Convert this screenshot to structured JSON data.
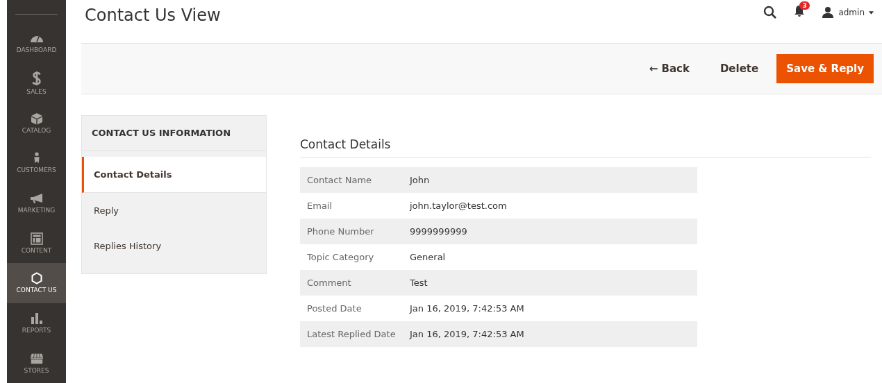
{
  "nav": [
    {
      "label": "DASHBOARD",
      "kind": "gauge",
      "selected": false
    },
    {
      "label": "SALES",
      "kind": "dollar",
      "selected": false
    },
    {
      "label": "CATALOG",
      "kind": "box",
      "selected": false
    },
    {
      "label": "CUSTOMERS",
      "kind": "person",
      "selected": false
    },
    {
      "label": "MARKETING",
      "kind": "megaphone",
      "selected": false
    },
    {
      "label": "CONTENT",
      "kind": "layout",
      "selected": false
    },
    {
      "label": "CONTACT US",
      "kind": "hexagon",
      "selected": true
    },
    {
      "label": "REPORTS",
      "kind": "bars",
      "selected": false
    },
    {
      "label": "STORES",
      "kind": "store",
      "selected": false
    }
  ],
  "page_title": "Contact Us View",
  "header": {
    "notification_count": "3",
    "user": "admin"
  },
  "actions": {
    "back": "← Back",
    "delete": "Delete",
    "primary": "Save & Reply"
  },
  "tabs_panel": {
    "title": "CONTACT US INFORMATION",
    "tabs": [
      {
        "label": "Contact Details",
        "selected": true
      },
      {
        "label": "Reply",
        "selected": false
      },
      {
        "label": "Replies History",
        "selected": false
      }
    ]
  },
  "section_title": "Contact Details",
  "details": [
    {
      "label": "Contact Name",
      "value": "John"
    },
    {
      "label": "Email",
      "value": "john.taylor@test.com"
    },
    {
      "label": "Phone Number",
      "value": "9999999999"
    },
    {
      "label": "Topic Category",
      "value": "General"
    },
    {
      "label": "Comment",
      "value": "Test"
    },
    {
      "label": "Posted Date",
      "value": "Jan 16, 2019, 7:42:53 AM"
    },
    {
      "label": "Latest Replied Date",
      "value": "Jan 16, 2019, 7:42:53 AM"
    }
  ]
}
